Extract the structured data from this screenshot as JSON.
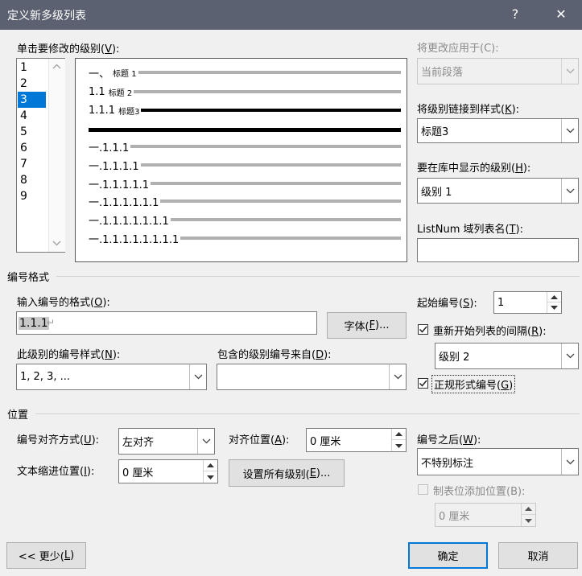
{
  "dialog": {
    "title": "定义新多级列表",
    "help": "?",
    "close": "✕"
  },
  "level_section": {
    "label_prefix": "单击要修改的级别(",
    "label_key": "V",
    "label_suffix": "):",
    "levels": [
      "1",
      "2",
      "3",
      "4",
      "5",
      "6",
      "7",
      "8",
      "9"
    ],
    "selected_level": "3"
  },
  "preview": {
    "rows": [
      {
        "num": "一、",
        "heading": "标题 1"
      },
      {
        "num": "1.1",
        "heading": "标题 2"
      },
      {
        "num": "1.1.1",
        "heading": "标题3"
      },
      {
        "num": "",
        "heading": ""
      },
      {
        "num": "一.1.1.1",
        "heading": ""
      },
      {
        "num": "一.1.1.1.1",
        "heading": ""
      },
      {
        "num": "一.1.1.1.1.1",
        "heading": ""
      },
      {
        "num": "一.1.1.1.1.1.1",
        "heading": ""
      },
      {
        "num": "一.1.1.1.1.1.1.1",
        "heading": ""
      },
      {
        "num": "一.1.1.1.1.1.1.1.1",
        "heading": ""
      }
    ]
  },
  "right_panel": {
    "apply_to_label_prefix": "将更改应用于(",
    "apply_to_key": "C",
    "apply_to_label_suffix": "):",
    "apply_to_value": "当前段落",
    "link_style_label_prefix": "将级别链接到样式(",
    "link_style_key": "K",
    "link_style_label_suffix": "):",
    "link_style_value": "标题3",
    "gallery_level_label_prefix": "要在库中显示的级别(",
    "gallery_level_key": "H",
    "gallery_level_label_suffix": "):",
    "gallery_level_value": "级别 1",
    "listnum_label_prefix": "ListNum 域列表名(",
    "listnum_key": "T",
    "listnum_label_suffix": "):",
    "listnum_value": ""
  },
  "number_format": {
    "section_title": "编号格式",
    "enter_format_label_prefix": "输入编号的格式(",
    "enter_format_key": "O",
    "enter_format_label_suffix": "):",
    "format_value": "1.1.1",
    "font_button_prefix": "字体(",
    "font_button_key": "F",
    "font_button_suffix": ")...",
    "style_label_prefix": "此级别的编号样式(",
    "style_key": "N",
    "style_label_suffix": "):",
    "style_value": "1, 2, 3, ...",
    "include_label_prefix": "包含的级别编号来自(",
    "include_key": "D",
    "include_label_suffix": "):",
    "include_value": "",
    "start_at_label_prefix": "起始编号(",
    "start_at_key": "S",
    "start_at_label_suffix": "):",
    "start_at_value": "1",
    "restart_label_prefix": "重新开始列表的间隔(",
    "restart_key": "R",
    "restart_label_suffix": "):",
    "restart_checked": true,
    "restart_value": "级别 2",
    "legal_label_prefix": "正规形式编号(",
    "legal_key": "G",
    "legal_label_suffix": ")",
    "legal_checked": true
  },
  "position": {
    "section_title": "位置",
    "alignment_label_prefix": "编号对齐方式(",
    "alignment_key": "U",
    "alignment_label_suffix": "):",
    "alignment_value": "左对齐",
    "aligned_at_label_prefix": "对齐位置(",
    "aligned_at_key": "A",
    "aligned_at_label_suffix": "):",
    "aligned_at_value": "0 厘米",
    "indent_label_prefix": "文本缩进位置(",
    "indent_key": "I",
    "indent_label_suffix": "):",
    "indent_value": "0 厘米",
    "set_all_prefix": "设置所有级别(",
    "set_all_key": "E",
    "set_all_suffix": ")...",
    "follow_label_prefix": "编号之后(",
    "follow_key": "W",
    "follow_label_suffix": "):",
    "follow_value": "不特别标注",
    "tab_stop_label": "制表位添加位置(B):",
    "tab_stop_checked": false,
    "tab_stop_value": "0 厘米"
  },
  "footer": {
    "less_prefix": "<< 更少(",
    "less_key": "L",
    "less_suffix": ")",
    "ok": "确定",
    "cancel": "取消"
  }
}
